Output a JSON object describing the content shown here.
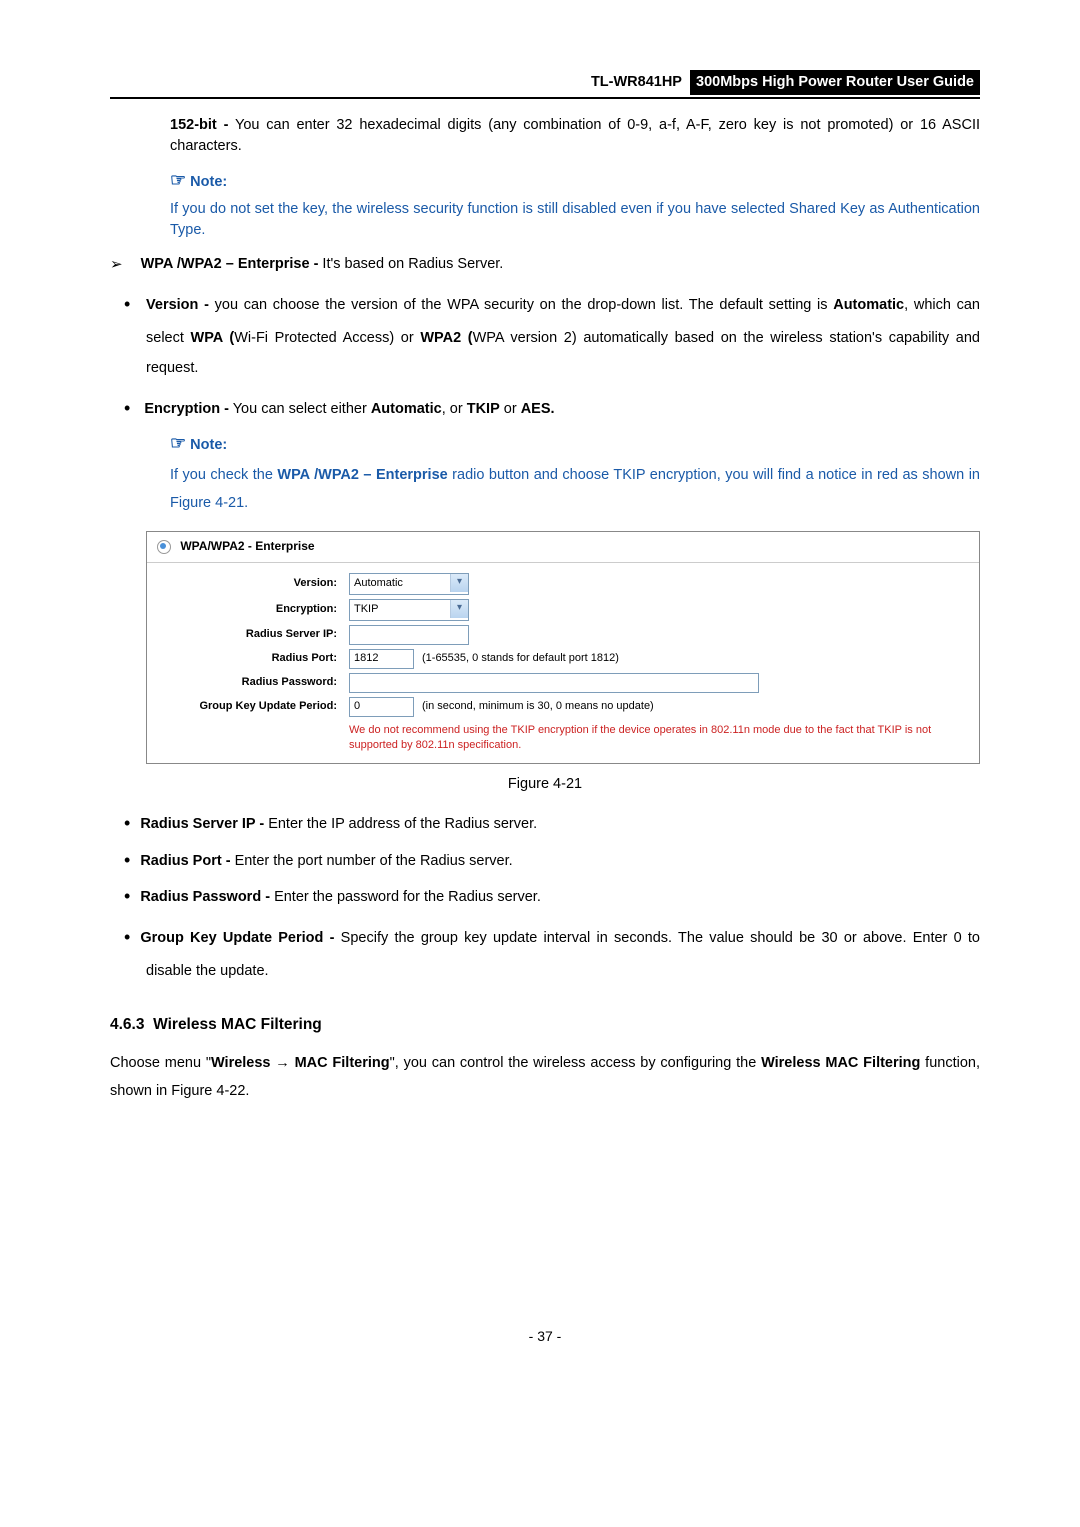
{
  "header": {
    "model": "TL-WR841HP",
    "title": "300Mbps High Power Router User Guide"
  },
  "p152bit": "152-bit - You can enter 32 hexadecimal digits (any combination of 0-9, a-f, A-F, zero key is not promoted) or 16 ASCII characters.",
  "note1": {
    "icon": "☞",
    "label": "Note:",
    "body": "If you do not set the key, the wireless security function is still disabled even if you have selected Shared Key as Authentication Type."
  },
  "wpa_ent": {
    "label": "WPA /WPA2 – Enterprise -",
    "rest": " It's based on Radius Server."
  },
  "version_bullet": {
    "b1": "Version -",
    "t1": " you can choose the version of the WPA security on the drop-down list. The default setting is ",
    "b2": "Automatic",
    "t2": ", which can select ",
    "b3": "WPA (",
    "t3": "Wi-Fi Protected Access) or ",
    "b4": "WPA2 (",
    "t4": "WPA version 2) automatically based on the wireless station's capability and request."
  },
  "encryption_bullet": {
    "b1": "Encryption -",
    "t1": "  You can select either ",
    "b2": "Automatic",
    "t2": ", or ",
    "b3": "TKIP",
    "t3": " or ",
    "b4": "AES."
  },
  "note2": {
    "icon": "☞",
    "label": "Note:",
    "t1": "If you check the ",
    "b1": "WPA /WPA2 – Enterprise",
    "t2": " radio button and choose TKIP encryption, you will find a notice in red as shown in Figure 4-21."
  },
  "figure": {
    "head": "WPA/WPA2 - Enterprise",
    "rows": {
      "version_label": "Version:",
      "version_val": "Automatic",
      "encryption_label": "Encryption:",
      "encryption_val": "TKIP",
      "server_ip_label": "Radius Server IP:",
      "server_ip_val": "",
      "port_label": "Radius Port:",
      "port_val": "1812",
      "port_hint": "(1-65535, 0 stands for default port 1812)",
      "password_label": "Radius Password:",
      "password_val": "",
      "period_label": "Group Key Update Period:",
      "period_val": "0",
      "period_hint": "(in second, minimum is 30, 0 means no update)"
    },
    "warn": "We do not recommend using the TKIP encryption if the device operates in 802.11n mode due to the fact that TKIP is not supported by 802.11n specification.",
    "caption": "Figure 4-21"
  },
  "bullets2": {
    "b1": "Radius Server IP -",
    "t1": " Enter the IP address of the Radius server.",
    "b2": "Radius Port -",
    "t2": " Enter the port number of the Radius server.",
    "b3": "Radius Password -",
    "t3": " Enter the password for the Radius server.",
    "b4": "Group Key Update Period -",
    "t4": " Specify the group key update interval in seconds. The value should be 30 or above. Enter 0 to disable the update."
  },
  "section": {
    "num": "4.6.3",
    "title": "Wireless MAC Filtering"
  },
  "section_para": {
    "t1": "Choose menu \"",
    "b1": "Wireless",
    "arrow": " → ",
    "b2": " MAC Filtering",
    "t2": "\", you can control the wireless access by configuring the ",
    "b3": "Wireless MAC Filtering",
    "t3": " function, shown in Figure 4-22."
  },
  "page_num": "- 37 -"
}
